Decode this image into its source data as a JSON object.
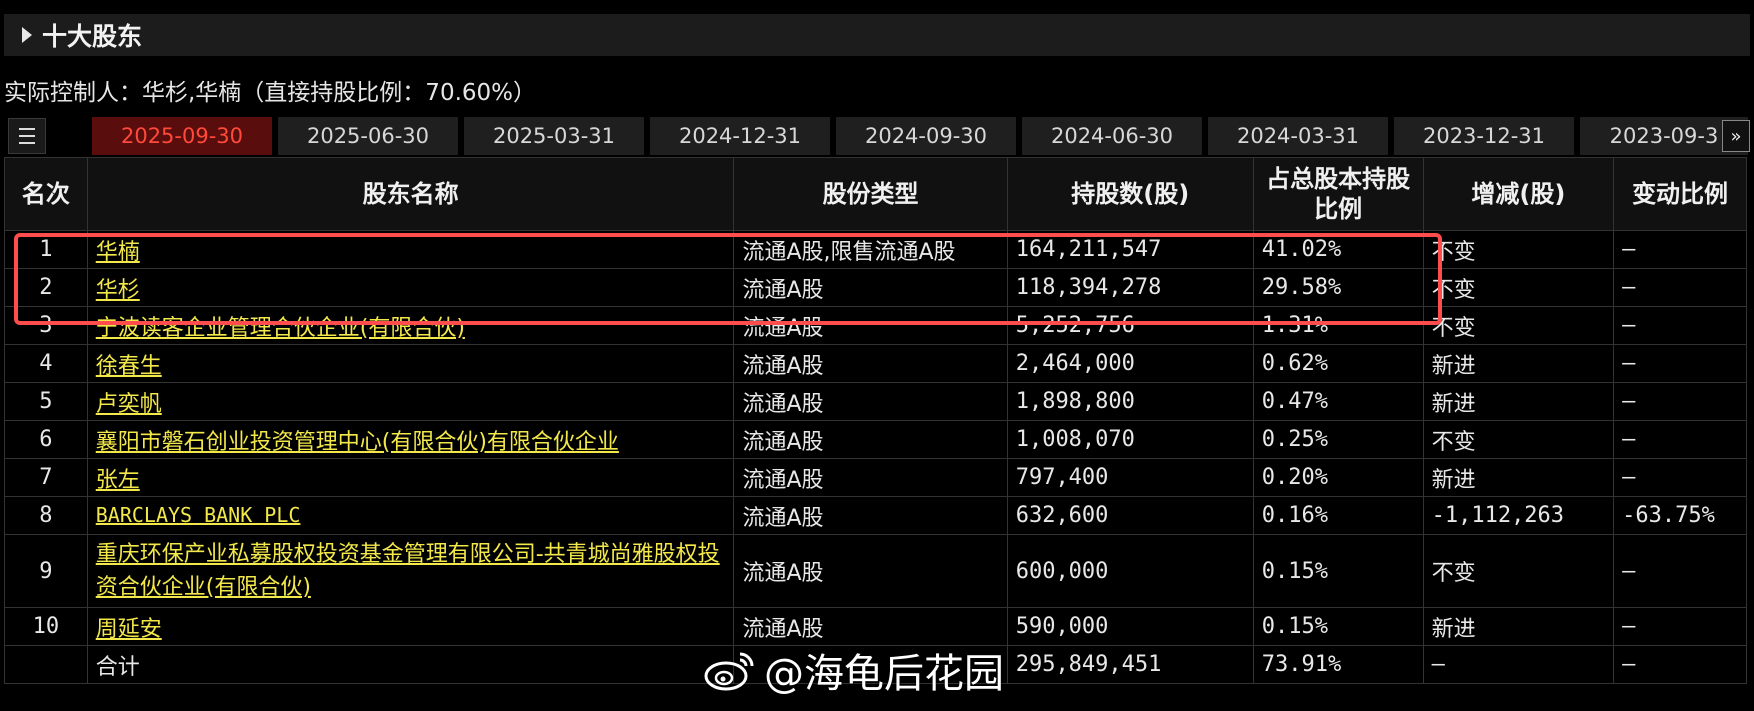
{
  "section": {
    "title": "十大股东"
  },
  "controller_text": "实际控制人：华杉,华楠（直接持股比例：70.60%）",
  "tabs": [
    "2025-09-30",
    "2025-06-30",
    "2025-03-31",
    "2024-12-31",
    "2024-09-30",
    "2024-06-30",
    "2024-03-31",
    "2023-12-31",
    "2023-09-3"
  ],
  "active_tab": "2025-09-30",
  "table": {
    "headers": {
      "rank": "名次",
      "name": "股东名称",
      "type": "股份类型",
      "shares": "持股数(股)",
      "ratio": "占总股本持股比例",
      "change": "增减(股)",
      "change_ratio": "变动比例"
    },
    "rows": [
      {
        "rank": "1",
        "name": "华楠",
        "type": "流通A股,限售流通A股",
        "shares": "164,211,547",
        "ratio": "41.02%",
        "change": "不变",
        "change_ratio": "—"
      },
      {
        "rank": "2",
        "name": "华杉",
        "type": "流通A股",
        "shares": "118,394,278",
        "ratio": "29.58%",
        "change": "不变",
        "change_ratio": "—"
      },
      {
        "rank": "3",
        "name": "宁波读客企业管理合伙企业(有限合伙)",
        "type": "流通A股",
        "shares": "5,252,756",
        "ratio": "1.31%",
        "change": "不变",
        "change_ratio": "—"
      },
      {
        "rank": "4",
        "name": "徐春生",
        "type": "流通A股",
        "shares": "2,464,000",
        "ratio": "0.62%",
        "change": "新进",
        "change_ratio": "—"
      },
      {
        "rank": "5",
        "name": "卢奕帆",
        "type": "流通A股",
        "shares": "1,898,800",
        "ratio": "0.47%",
        "change": "新进",
        "change_ratio": "—"
      },
      {
        "rank": "6",
        "name": "襄阳市磐石创业投资管理中心(有限合伙)有限合伙企业",
        "type": "流通A股",
        "shares": "1,008,070",
        "ratio": "0.25%",
        "change": "不变",
        "change_ratio": "—"
      },
      {
        "rank": "7",
        "name": "张左",
        "type": "流通A股",
        "shares": "797,400",
        "ratio": "0.20%",
        "change": "新进",
        "change_ratio": "—"
      },
      {
        "rank": "8",
        "name": "BARCLAYS BANK PLC",
        "type": "流通A股",
        "shares": "632,600",
        "ratio": "0.16%",
        "change": "-1,112,263",
        "change_ratio": "-63.75%"
      },
      {
        "rank": "9",
        "name": "重庆环保产业私募股权投资基金管理有限公司-共青城尚雅股权投资合伙企业(有限合伙)",
        "type": "流通A股",
        "shares": "600,000",
        "ratio": "0.15%",
        "change": "不变",
        "change_ratio": "—"
      },
      {
        "rank": "10",
        "name": "周延安",
        "type": "流通A股",
        "shares": "590,000",
        "ratio": "0.15%",
        "change": "新进",
        "change_ratio": "—"
      }
    ],
    "total": {
      "label": "合计",
      "shares": "295,849,451",
      "ratio": "73.91%",
      "change": "—",
      "change_ratio": "—"
    }
  },
  "watermark": "@海龟后花园",
  "colors": {
    "new_entry": "#ff4a3a",
    "decrease": "#2fd14a",
    "holder_link": "#f2e84a",
    "highlight_box": "#ff4d4d"
  },
  "icons": {
    "tab_menu": "list-icon",
    "tab_next": "double-chevron-right-icon",
    "section_toggle": "triangle-right-icon",
    "watermark": "weibo-icon"
  }
}
